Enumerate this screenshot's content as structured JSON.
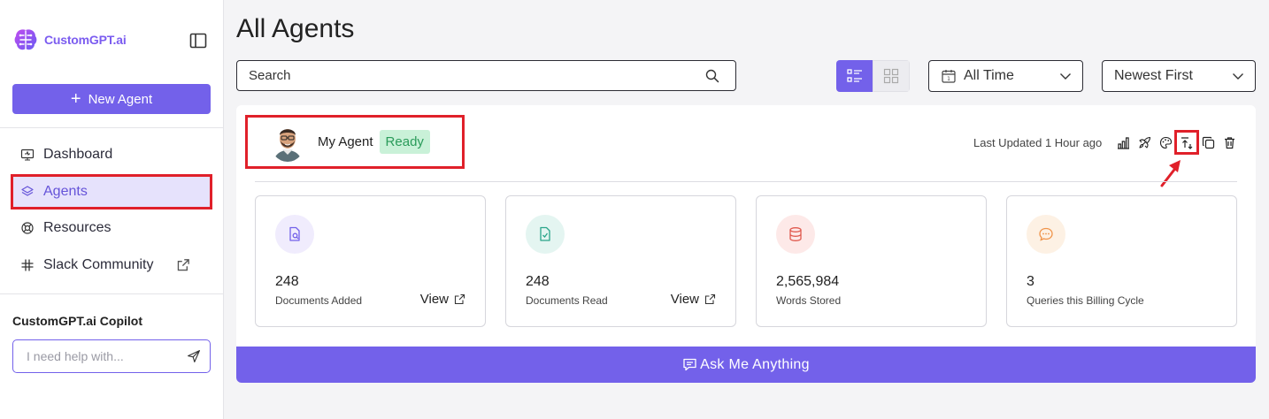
{
  "brand": {
    "name": "CustomGPT.ai",
    "color": "#7b5cf0"
  },
  "sidebar": {
    "new_agent_label": "New Agent",
    "items": [
      {
        "label": "Dashboard",
        "icon": "monitor-icon"
      },
      {
        "label": "Agents",
        "icon": "layers-icon",
        "active": true
      },
      {
        "label": "Resources",
        "icon": "lifebuoy-icon"
      },
      {
        "label": "Slack Community",
        "icon": "slack-icon",
        "external": true
      }
    ],
    "copilot": {
      "title": "CustomGPT.ai Copilot",
      "placeholder": "I need help with..."
    }
  },
  "main": {
    "title": "All Agents",
    "search": {
      "placeholder": "Search"
    },
    "time_filter": {
      "value": "All Time"
    },
    "sort": {
      "value": "Newest First"
    },
    "view_mode": "list"
  },
  "agent": {
    "name": "My Agent",
    "status": "Ready",
    "last_updated": "Last Updated 1 Hour ago",
    "actions": [
      "analytics-icon",
      "deploy-icon",
      "personalize-icon",
      "upload-icon",
      "duplicate-icon",
      "delete-icon"
    ],
    "highlighted_action": "upload-icon",
    "stats": [
      {
        "value": "248",
        "label": "Documents Added",
        "view": "View",
        "icon": "document-search-icon",
        "tint": "#f0ecfd",
        "color": "#7361ea"
      },
      {
        "value": "248",
        "label": "Documents Read",
        "view": "View",
        "icon": "document-check-icon",
        "tint": "#e4f5f1",
        "color": "#2aa58a"
      },
      {
        "value": "2,565,984",
        "label": "Words Stored",
        "icon": "database-icon",
        "tint": "#fde9e8",
        "color": "#e05a4f"
      },
      {
        "value": "3",
        "label": "Queries this Billing Cycle",
        "icon": "chat-icon",
        "tint": "#fdf1e4",
        "color": "#f0944a"
      }
    ],
    "ask_label": "Ask Me Anything"
  },
  "colors": {
    "accent": "#7361ea",
    "annotation": "#e0202a",
    "ready_bg": "#c9f1d8",
    "ready_text": "#2a9b5a"
  }
}
